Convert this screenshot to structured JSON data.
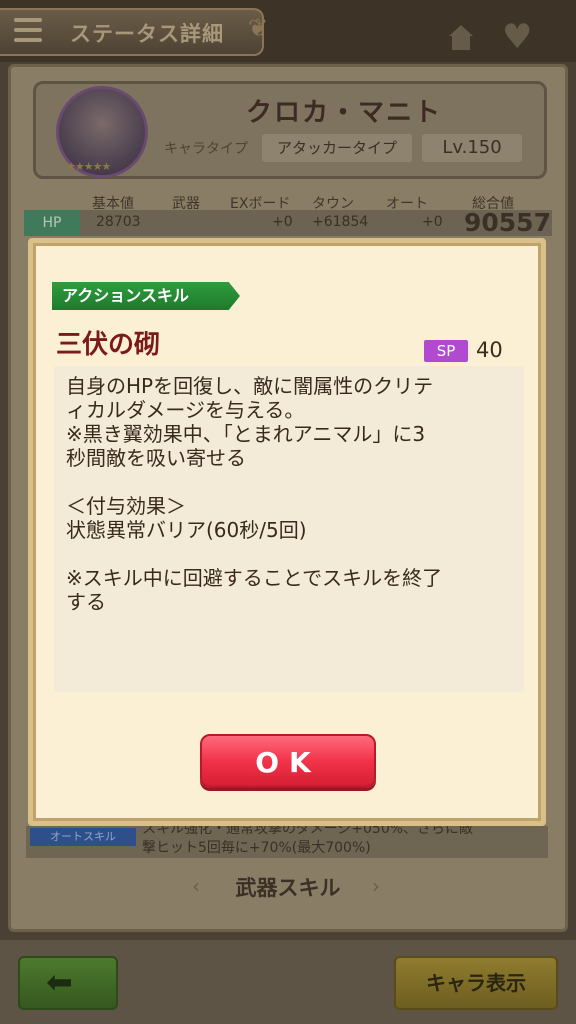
{
  "header": {
    "title": "ステータス詳細"
  },
  "character": {
    "name": "クロカ・マニト",
    "type_label": "キャラタイプ",
    "type_value": "アタッカータイプ",
    "level": "Lv.150"
  },
  "stats": {
    "headers": [
      "基本値",
      "武器",
      "EXボード",
      "タウン",
      "オート",
      "総合値"
    ],
    "hp": {
      "label": "HP",
      "base": "28703",
      "ex": "+0",
      "town": "+61854",
      "auto": "+0",
      "total": "90557"
    }
  },
  "auto_skill": {
    "label": "オートスキル",
    "line1": "スキル強化・通常攻撃のダメージ+050%、さらに敵",
    "line2": "撃ヒット5回毎に+70%(最大700%)"
  },
  "weapon_skill": "武器スキル",
  "footer": {
    "chara_button": "キャラ表示"
  },
  "modal": {
    "tag": "アクションスキル",
    "skill_name": "三伏の砌",
    "sp_label": "SP",
    "sp_value": "40",
    "description": {
      "l1": "自身のHPを回復し、敵に闇属性のクリテ",
      "l2": "ィカルダメージを与える。",
      "l3": "※黒き翼効果中、「とまれアニマル」に3",
      "l4": "秒間敵を吸い寄せる",
      "l5": "＜付与効果＞",
      "l6": "状態異常バリア(60秒/5回)",
      "l7": "※スキル中に回避することでスキルを終了",
      "l8": "する"
    },
    "ok_label": "OK"
  }
}
